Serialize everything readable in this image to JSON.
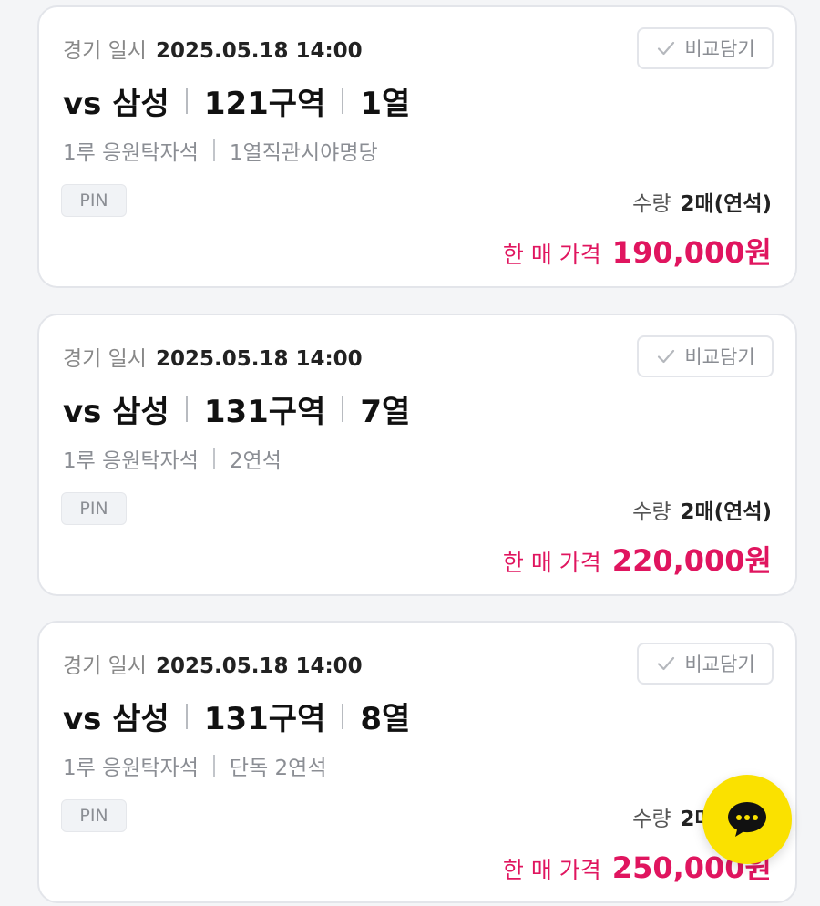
{
  "listings": [
    {
      "date_label": "경기 일시",
      "date_value": "2025.05.18 14:00",
      "compare_label": "비교담기",
      "opponent": "vs 삼성",
      "section": "121구역",
      "row": "1열",
      "seat_zone": "1루 응원탁자석",
      "seat_note": "1열직관시야명당",
      "badge": "PIN",
      "qty_label": "수량",
      "qty_value": "2매(연석)",
      "price_label": "한 매 가격",
      "price_value": "190,000원"
    },
    {
      "date_label": "경기 일시",
      "date_value": "2025.05.18 14:00",
      "compare_label": "비교담기",
      "opponent": "vs 삼성",
      "section": "131구역",
      "row": "7열",
      "seat_zone": "1루 응원탁자석",
      "seat_note": "2연석",
      "badge": "PIN",
      "qty_label": "수량",
      "qty_value": "2매(연석)",
      "price_label": "한 매 가격",
      "price_value": "220,000원"
    },
    {
      "date_label": "경기 일시",
      "date_value": "2025.05.18 14:00",
      "compare_label": "비교담기",
      "opponent": "vs 삼성",
      "section": "131구역",
      "row": "8열",
      "seat_zone": "1루 응원탁자석",
      "seat_note": "단독 2연석",
      "badge": "PIN",
      "qty_label": "수량",
      "qty_value": "2매(연석)",
      "price_label": "한 매 가격",
      "price_value": "250,000원"
    }
  ],
  "chat_button": {
    "icon": "chat-bubble-icon",
    "color": "#fae100"
  },
  "colors": {
    "price": "#e0155f",
    "chat_fab": "#fae100"
  }
}
